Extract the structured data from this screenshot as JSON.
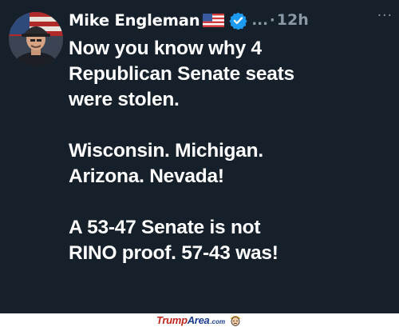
{
  "post": {
    "author_name": "Mike Engleman",
    "flag_icon": "us-flag-icon",
    "badge_icon": "verified-badge-icon",
    "badge_color": "#1d9bf0",
    "handle_truncated": "...",
    "separator": "·",
    "timestamp": "12h",
    "more_label": "···",
    "paragraphs": [
      [
        "Now you know why 4",
        "Republican Senate seats",
        "were stolen."
      ],
      [
        "Wisconsin. Michigan.",
        "Arizona. Nevada!"
      ],
      [
        "A 53-47 Senate is not",
        "RINO proof. 57-43 was!"
      ]
    ]
  },
  "watermark": {
    "brand_part1": "Trump",
    "brand_part2": "Area",
    "brand_suffix": ".com"
  },
  "colors": {
    "background": "#16202b",
    "text": "#ffffff",
    "muted": "#8b98a5"
  }
}
